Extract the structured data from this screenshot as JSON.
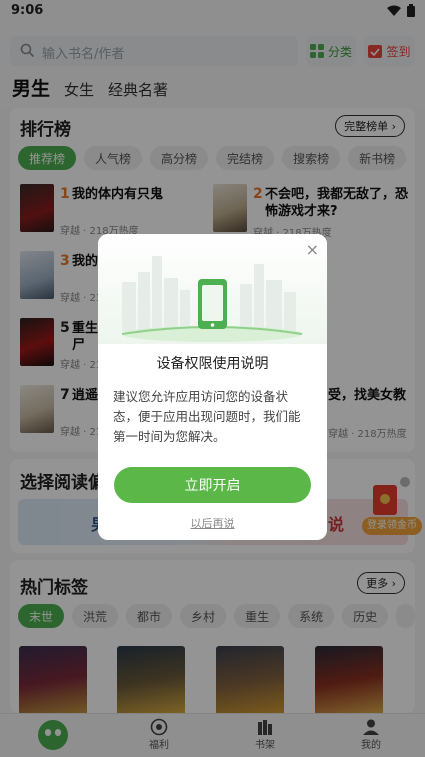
{
  "status_bar": {
    "time": "9:06"
  },
  "search": {
    "placeholder": "输入书名/作者"
  },
  "header": {
    "category_label": "分类",
    "checkin_label": "签到"
  },
  "top_tabs": [
    "男生",
    "女生",
    "经典名著"
  ],
  "ranking": {
    "title": "排行榜",
    "more_label": "完整榜单 ›",
    "chips": [
      "推荐榜",
      "人气榜",
      "高分榜",
      "完结榜",
      "搜索榜",
      "新书榜"
    ],
    "items": [
      {
        "num": "1",
        "title": "我的体内有只鬼",
        "meta": "穿越 · 218万热度"
      },
      {
        "num": "2",
        "title": "不会吧，我都无敌了，恐怖游戏才来?",
        "meta": "穿越 · 218万热度"
      },
      {
        "num": "3",
        "title": "我的",
        "meta": "穿越 · 218万热度"
      },
      {
        "num": "5",
        "title": "重生丧尸",
        "meta": "穿越 · 218万热度"
      },
      {
        "num": "7",
        "title": "逍遥",
        "meta": "穿越 · 218万热度"
      },
      {
        "num": "",
        "title": "受，找美女教",
        "meta": "穿越 · 218万热度"
      }
    ]
  },
  "preference": {
    "title": "选择阅读偏",
    "left_label": "男",
    "right_label": "说",
    "coin_label": "登录领金币"
  },
  "hot_tags": {
    "title": "热门标签",
    "more_label": "更多 ›",
    "chips": [
      "末世",
      "洪荒",
      "都市",
      "乡村",
      "重生",
      "系统",
      "历史"
    ]
  },
  "bottom_nav": [
    "福利",
    "书架",
    "我的"
  ],
  "dialog": {
    "close_icon": "×",
    "title": "设备权限使用说明",
    "body": "建议您允许应用访问您的设备状态，便于应用出现问题时，我们能第一时间为您解决。",
    "primary_label": "立即开启",
    "secondary_label": "以后再说"
  },
  "colors": {
    "accent": "#5bb848",
    "rank_number": "#e8772e",
    "checkin": "#e8453c"
  }
}
